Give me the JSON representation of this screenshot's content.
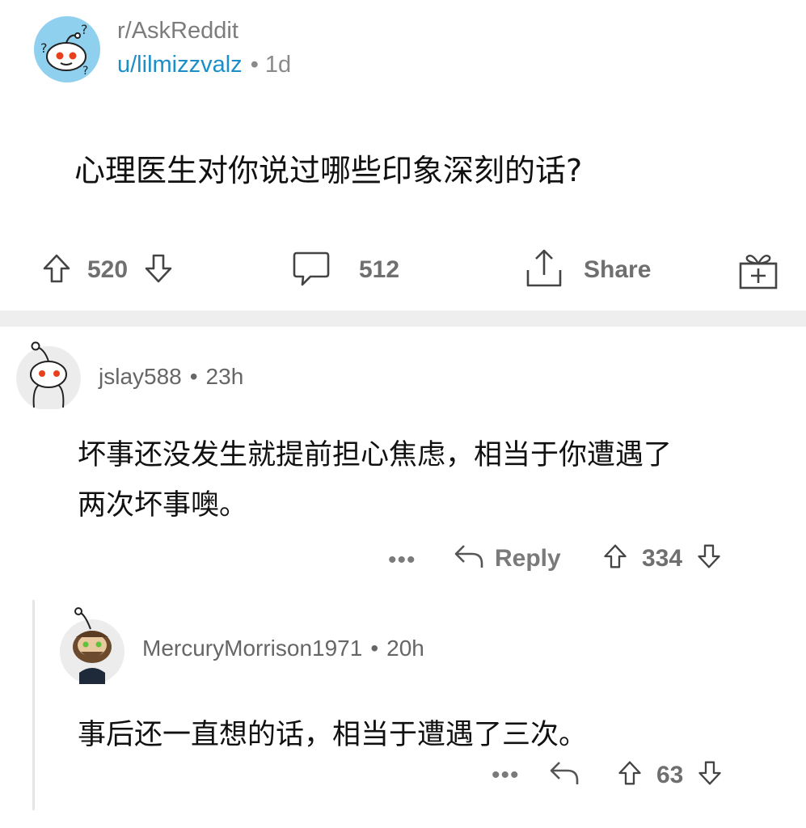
{
  "post": {
    "subreddit": "r/AskReddit",
    "author": "u/lilmizzvalz",
    "separator": "•",
    "age": "1d",
    "title": "心理医生对你说过哪些印象深刻的话?",
    "votes": "520",
    "comments": "512",
    "share_label": "Share"
  },
  "comments": [
    {
      "author": "jslay588",
      "separator": "•",
      "age": "23h",
      "body_line1": "坏事还没发生就提前担心焦虑，相当于你遭遇了",
      "body_line2": "两次坏事噢。",
      "more": "•••",
      "reply_label": "Reply",
      "score": "334"
    },
    {
      "author": "MercuryMorrison1971",
      "separator": "•",
      "age": "20h",
      "body": "事后还一直想的话，相当于遭遇了三次。",
      "more": "•••",
      "score": "63"
    }
  ],
  "icons": {
    "upvote": "arrow-up-outline",
    "downvote": "arrow-down-outline",
    "comment": "speech-bubble",
    "share": "share-upload",
    "award": "gift-box",
    "reply": "reply-arrow",
    "more": "ellipsis"
  },
  "colors": {
    "author_link": "#1c8fc9",
    "muted": "#7c7c7c",
    "avatar_bg": "#8fd0ee",
    "snoo_eye": "#e8401c"
  }
}
